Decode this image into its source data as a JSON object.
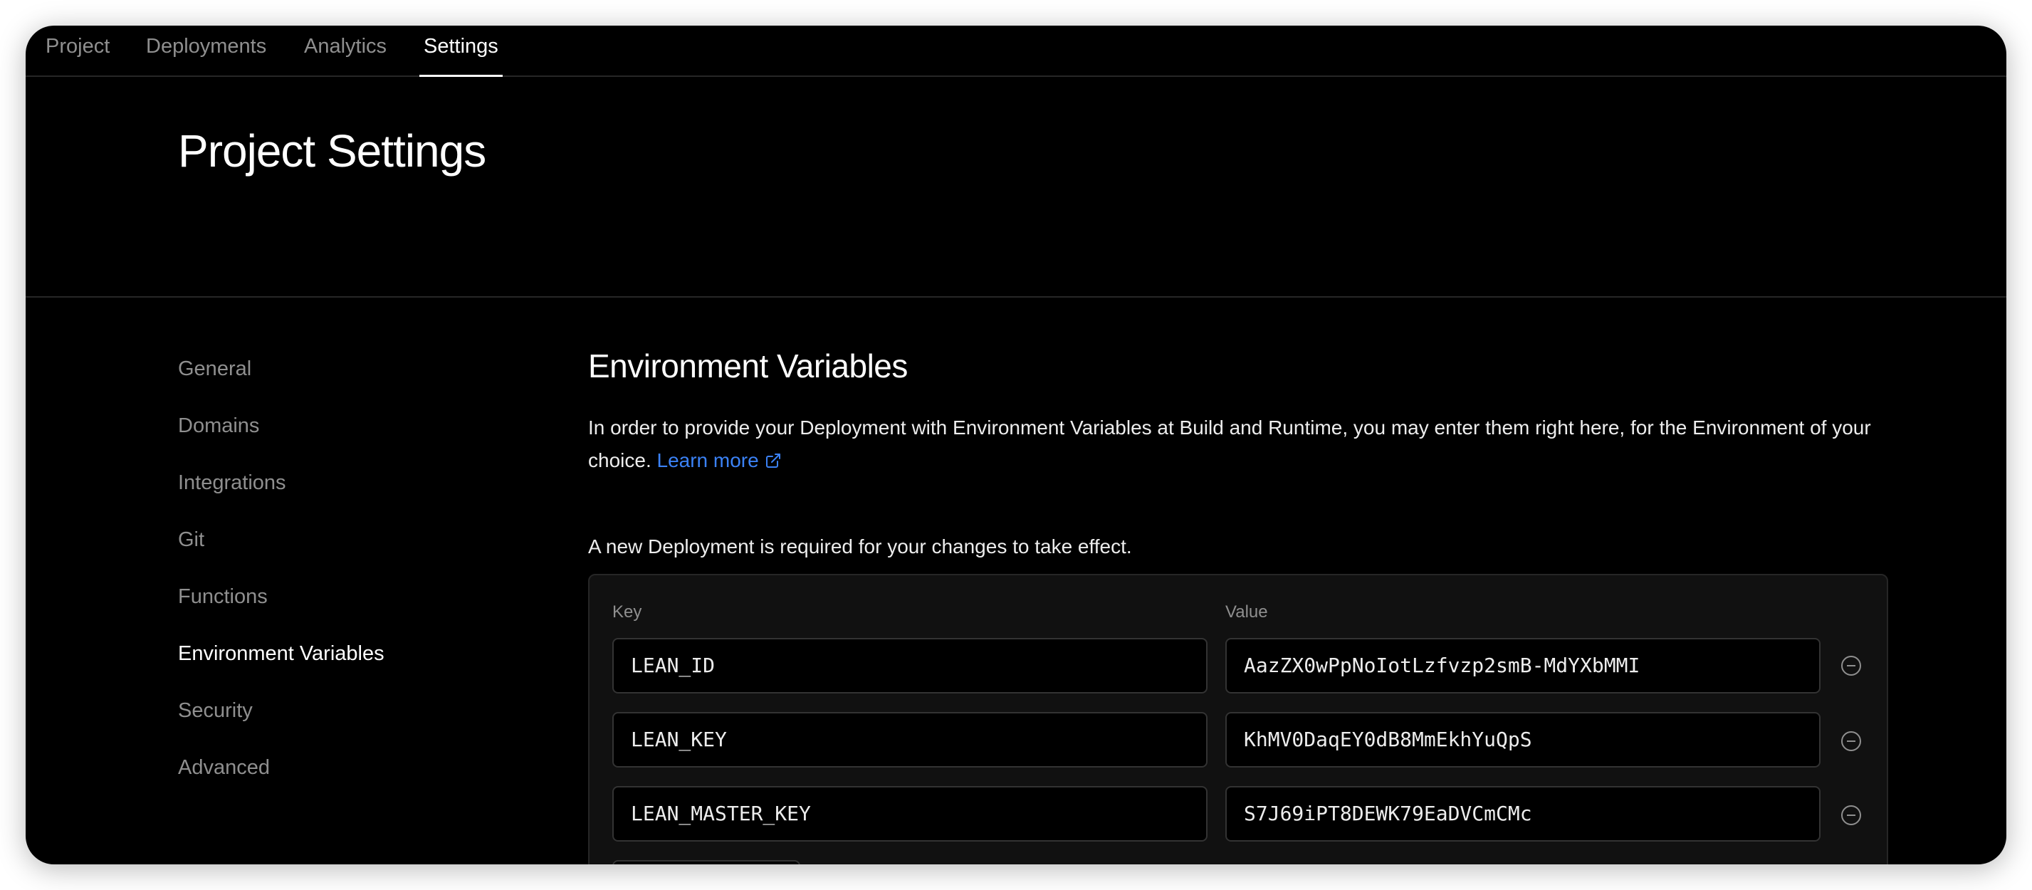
{
  "tabs": [
    {
      "label": "Project"
    },
    {
      "label": "Deployments"
    },
    {
      "label": "Analytics"
    },
    {
      "label": "Settings",
      "active": true
    }
  ],
  "page_title": "Project Settings",
  "sidebar": {
    "items": [
      {
        "label": "General"
      },
      {
        "label": "Domains"
      },
      {
        "label": "Integrations"
      },
      {
        "label": "Git"
      },
      {
        "label": "Functions"
      },
      {
        "label": "Environment Variables",
        "active": true
      },
      {
        "label": "Security"
      },
      {
        "label": "Advanced"
      }
    ]
  },
  "env": {
    "title": "Environment Variables",
    "description": "In order to provide your Deployment with Environment Variables at Build and Runtime, you may enter them right here, for the Environment of your choice.",
    "learn_more": "Learn more",
    "note": "A new Deployment is required for your changes to take effect.",
    "key_label": "Key",
    "value_label": "Value",
    "rows": [
      {
        "key": "LEAN_ID",
        "value": "AazZX0wPpNoIotLzfvzp2smB-MdYXbMMI"
      },
      {
        "key": "LEAN_KEY",
        "value": "KhMV0DaqEY0dB8MmEkhYuQpS"
      },
      {
        "key": "LEAN_MASTER_KEY",
        "value": "S7J69iPT8DEWK79EaDVCmCMc"
      }
    ]
  },
  "colors": {
    "background": "#000000",
    "link": "#3b82f6",
    "muted_text": "#8f8f8f",
    "text": "#ededed"
  }
}
